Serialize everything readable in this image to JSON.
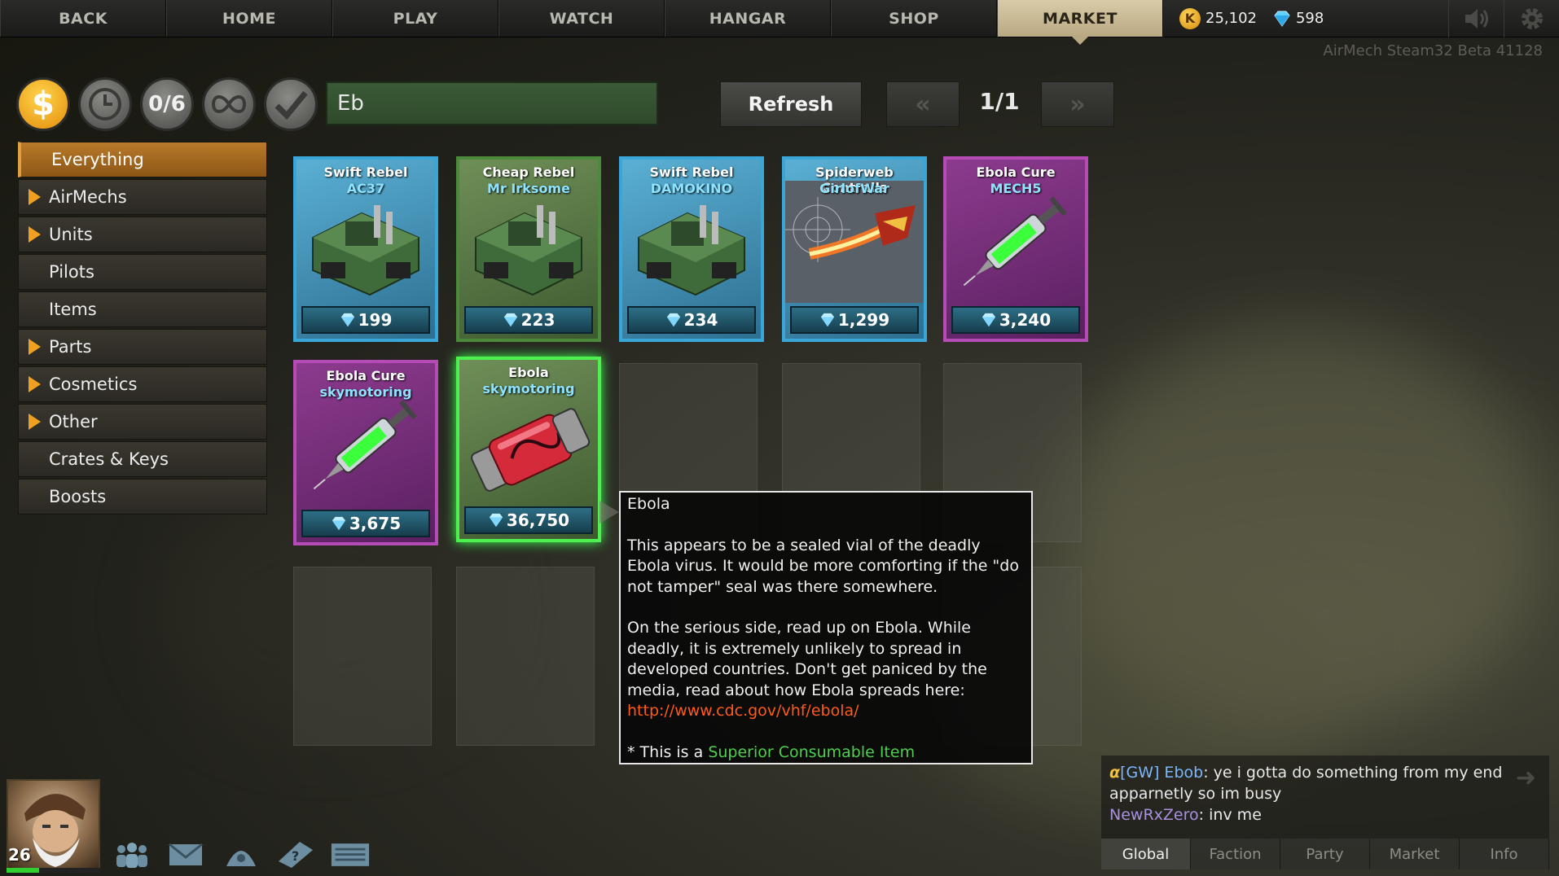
{
  "nav": {
    "items": [
      "BACK",
      "HOME",
      "PLAY",
      "WATCH",
      "HANGAR",
      "SHOP",
      "MARKET"
    ],
    "active": "MARKET"
  },
  "wallet": {
    "kudos": "25,102",
    "diamonds": "598",
    "kudos_symbol": "K"
  },
  "version": "AirMech Steam32 Beta 41128",
  "filters": {
    "currency_symbol": "$",
    "count_label": "0/6"
  },
  "search": {
    "value": "Eb"
  },
  "toolbar": {
    "refresh_label": "Refresh",
    "page_label": "1/1"
  },
  "sidebar": {
    "items": [
      {
        "label": "Everything",
        "expandable": false,
        "active": true
      },
      {
        "label": "AirMechs",
        "expandable": true
      },
      {
        "label": "Units",
        "expandable": true
      },
      {
        "label": "Pilots",
        "expandable": false
      },
      {
        "label": "Items",
        "expandable": false
      },
      {
        "label": "Parts",
        "expandable": true
      },
      {
        "label": "Cosmetics",
        "expandable": true
      },
      {
        "label": "Other",
        "expandable": true
      },
      {
        "label": "Crates & Keys",
        "expandable": false
      },
      {
        "label": "Boosts",
        "expandable": false
      }
    ]
  },
  "listings": [
    {
      "title": "Swift Rebel",
      "seller": "AC37",
      "price": "199",
      "rarity": "blue",
      "art": "tank"
    },
    {
      "title": "Cheap Rebel",
      "seller": "Mr Irksome",
      "price": "223",
      "rarity": "green",
      "art": "tank"
    },
    {
      "title": "Swift Rebel",
      "seller": "DAMOKINO",
      "price": "234",
      "rarity": "blue",
      "art": "tank"
    },
    {
      "title": "Spiderweb Contrails",
      "seller": "GirlofWar",
      "price": "1,299",
      "rarity": "blue",
      "art": "contrail"
    },
    {
      "title": "Ebola Cure",
      "seller": "MECH5",
      "price": "3,240",
      "rarity": "purple",
      "art": "syringe"
    },
    {
      "title": "Ebola Cure",
      "seller": "skymotoring",
      "price": "3,675",
      "rarity": "purple",
      "art": "syringe"
    },
    {
      "title": "Ebola",
      "seller": "skymotoring",
      "price": "36,750",
      "rarity": "green",
      "art": "vial",
      "highlighted": true
    }
  ],
  "tooltip": {
    "title": "Ebola",
    "para1": "This appears to be a sealed vial of the deadly Ebola virus. It would be more comforting if the \"do not tamper\" seal was there somewhere.",
    "para2": "On the serious side, read up on Ebola. While deadly, it is extremely unlikely to spread in developed countries. Don't get paniced by the media, read about how Ebola spreads here:",
    "link": "http://www.cdc.gov/vhf/ebola/",
    "footer_prefix": "* This is a ",
    "footer_class": "Superior Consumable Item"
  },
  "player": {
    "level": "26",
    "xp_fraction": 0.35
  },
  "chat": {
    "messages": [
      {
        "name": "[GW] Ebob",
        "text": "ye i gotta do something from my end apparnetly so im busy"
      },
      {
        "name": "NewRxZero",
        "text": "inv me"
      }
    ],
    "tabs": [
      "Global",
      "Faction",
      "Party",
      "Market",
      "Info"
    ],
    "active_tab": "Global"
  },
  "colors": {
    "accent_gold": "#f0a020",
    "market_tab": "#d9cba8",
    "rare_blue": "#3aa6d8",
    "epic_purple": "#b54bb4",
    "superior_green": "#4cd04c",
    "link": "#ff5a1a"
  }
}
